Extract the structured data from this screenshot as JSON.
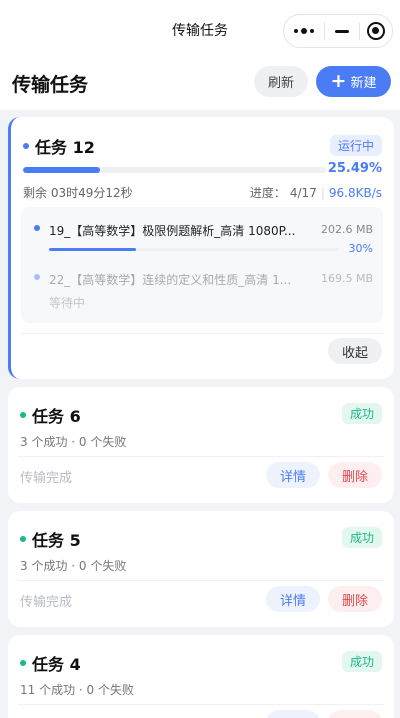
{
  "topbar": {
    "title": "传输任务"
  },
  "header": {
    "page_title": "传输任务",
    "refresh_label": "刷新",
    "new_label": "新建",
    "new_icon": "plus-icon"
  },
  "colors": {
    "accent": "#4a7cf6",
    "success": "#18b98a",
    "danger": "#e5484d"
  },
  "running_task": {
    "title": "任务 12",
    "status": "运行中",
    "progress_percent_label": "25.49%",
    "progress_fraction": 0.2549,
    "remaining": "剩余 03时49分12秒",
    "progress_label": "进度：",
    "progress_count": "4/17",
    "speed": "96.8KB/s",
    "files": [
      {
        "name": "19_【高等数学】极限例题解析_高清 1080P...",
        "size": "202.6 MB",
        "percent_label": "30%",
        "fraction": 0.3
      },
      {
        "name": "22_【高等数学】连续的定义和性质_高清 1...",
        "size": "169.5 MB",
        "state": "等待中"
      }
    ],
    "collapse_label": "收起"
  },
  "done_tasks": [
    {
      "title": "任务 6",
      "status": "成功",
      "summary": "3 个成功 · 0 个失败",
      "footer": "传输完成",
      "detail_label": "详情",
      "delete_label": "删除"
    },
    {
      "title": "任务 5",
      "status": "成功",
      "summary": "3 个成功 · 0 个失败",
      "footer": "传输完成",
      "detail_label": "详情",
      "delete_label": "删除"
    },
    {
      "title": "任务 4",
      "status": "成功",
      "summary": "11 个成功 · 0 个失败"
    }
  ]
}
